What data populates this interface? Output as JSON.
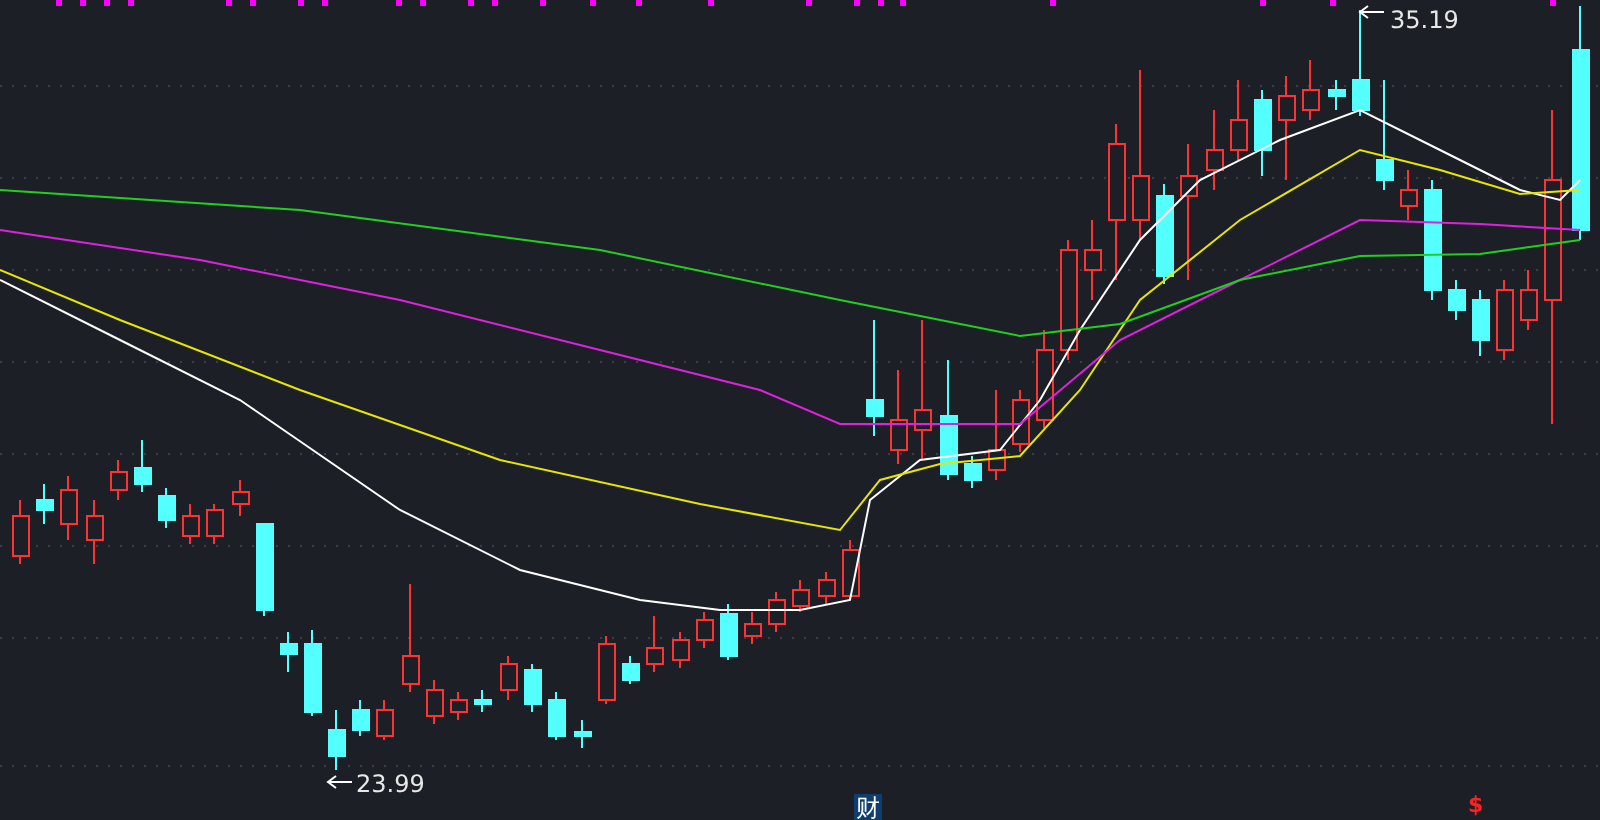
{
  "chart": {
    "high_label": "35.19",
    "low_label": "23.99"
  },
  "markers": [
    {
      "text": "财",
      "kind": "finance"
    },
    {
      "text": "$",
      "kind": "dividend"
    }
  ]
}
